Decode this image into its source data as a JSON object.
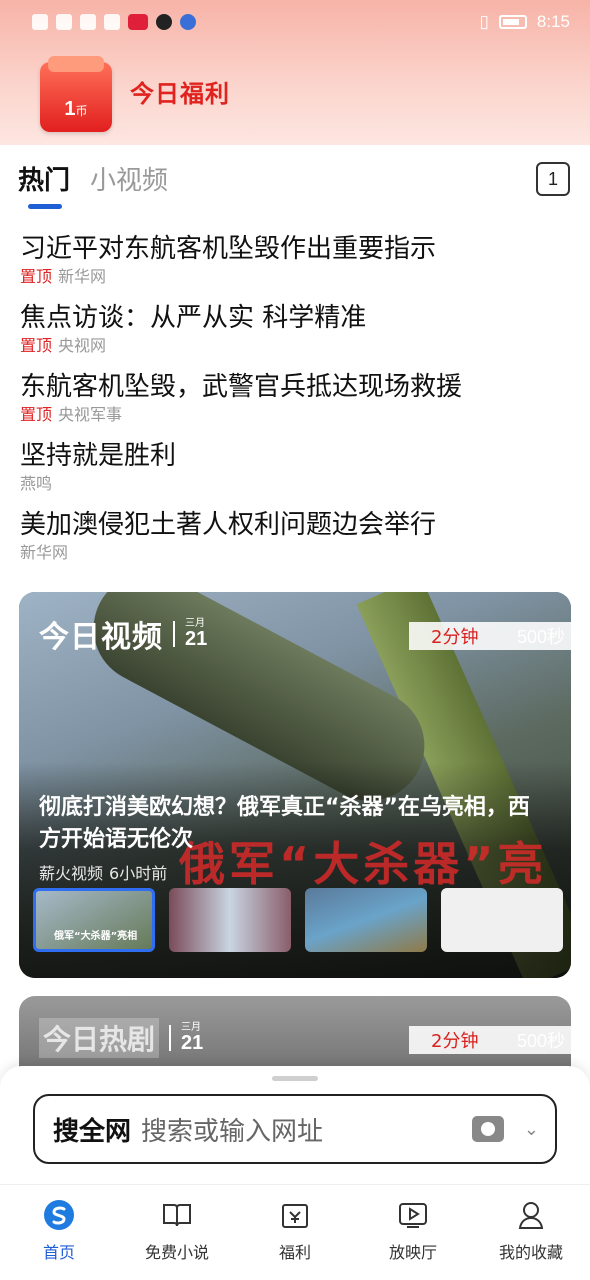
{
  "status_bar": {
    "time": "8:15"
  },
  "welfare": {
    "title": "今日福利",
    "coin_amount": "1",
    "coin_unit": "币"
  },
  "tabs": {
    "items": [
      "热门",
      "小视频"
    ],
    "count": "1"
  },
  "news": [
    {
      "title": "习近平对东航客机坠毁作出重要指示",
      "pin": "置顶",
      "source": "新华网"
    },
    {
      "title": "焦点访谈：从严从实 科学精准",
      "pin": "置顶",
      "source": "央视网"
    },
    {
      "title": "东航客机坠毁，武警官兵抵达现场救援",
      "pin": "置顶",
      "source": "央视军事"
    },
    {
      "title": "坚持就是胜利",
      "pin": "",
      "source": "燕鸣"
    },
    {
      "title": "美加澳侵犯土著人权利问题边会举行",
      "pin": "",
      "source": "新华网"
    }
  ],
  "video_card": {
    "logo": "今日视频",
    "month": "三月",
    "day": "21",
    "duration_label": "2分钟",
    "duration_value": "500秒",
    "title": "彻底打消美欧幻想？俄军真正“杀器”在乌亮相，西方开始语无伦次",
    "source": "薪火视频",
    "time_ago": "6小时前",
    "overlay_caption": "俄军“大杀器”亮相",
    "thumb_caption": "俄军“大杀器”亮相"
  },
  "drama_card": {
    "logo": "今日热剧",
    "month": "三月",
    "day": "21",
    "duration_label": "2分钟",
    "duration_value": "500秒"
  },
  "search": {
    "label": "搜全网",
    "placeholder": "搜索或输入网址"
  },
  "bottom_nav": [
    {
      "label": "首页",
      "icon": "home-icon"
    },
    {
      "label": "免费小说",
      "icon": "book-icon"
    },
    {
      "label": "福利",
      "icon": "coupon-icon"
    },
    {
      "label": "放映厅",
      "icon": "play-icon"
    },
    {
      "label": "我的收藏",
      "icon": "person-icon"
    }
  ]
}
